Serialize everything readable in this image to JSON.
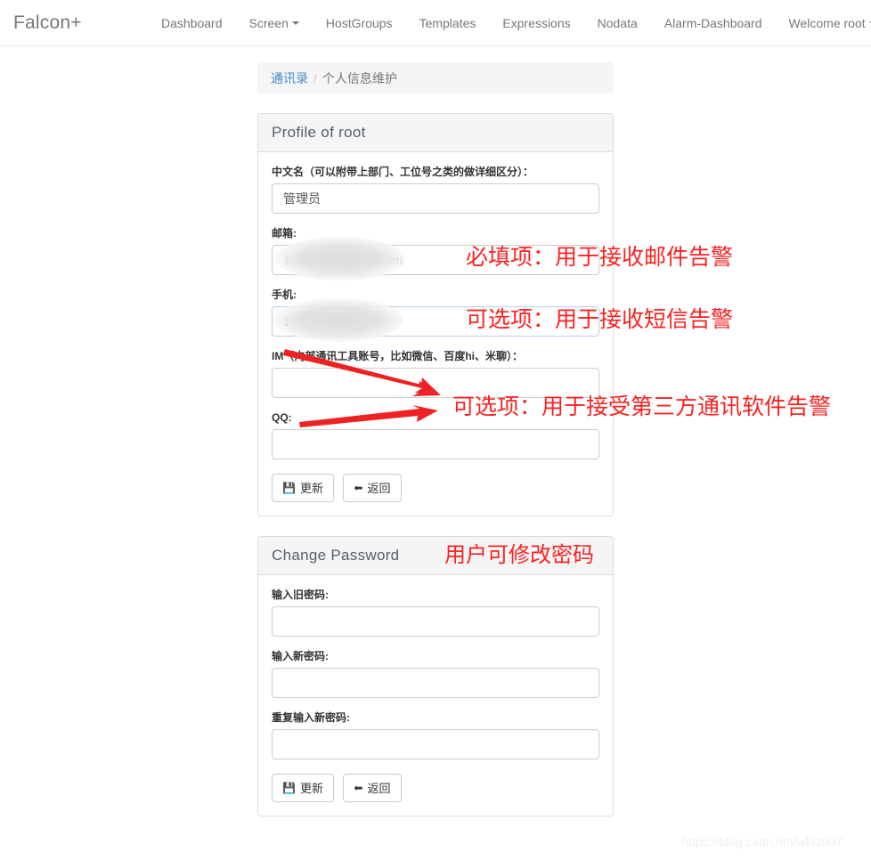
{
  "navbar": {
    "brand": "Falcon+",
    "items": [
      {
        "label": "Dashboard",
        "caret": false
      },
      {
        "label": "Screen",
        "caret": true
      },
      {
        "label": "HostGroups",
        "caret": false
      },
      {
        "label": "Templates",
        "caret": false
      },
      {
        "label": "Expressions",
        "caret": false
      },
      {
        "label": "Nodata",
        "caret": false
      },
      {
        "label": "Alarm-Dashboard",
        "caret": false
      },
      {
        "label": "Welcome root",
        "caret": true
      }
    ]
  },
  "breadcrumb": {
    "link": "通讯录",
    "separator": "/",
    "current": "个人信息维护"
  },
  "profile_panel": {
    "title": "Profile of root",
    "fields": {
      "cnname_label": "中文名（可以附带上部门、工位号之类的做详细区分）：",
      "cnname_value": "管理员",
      "email_label": "邮箱:",
      "email_prefix": "1",
      "email_suffix": "@163.com",
      "phone_label": "手机:",
      "phone_prefix": "1",
      "im_label": "IM（内部通讯工具账号，比如微信、百度hi、米聊）：",
      "im_value": "",
      "qq_label": "QQ:",
      "qq_value": ""
    },
    "buttons": {
      "update": "更新",
      "update_icon": "floppy-disk-icon",
      "back": "返回",
      "back_icon": "arrow-left-icon"
    }
  },
  "password_panel": {
    "title": "Change Password",
    "fields": {
      "old_label": "输入旧密码:",
      "old_value": "",
      "new_label": "输入新密码:",
      "new_value": "",
      "repeat_label": "重复输入新密码:",
      "repeat_value": ""
    },
    "buttons": {
      "update": "更新",
      "update_icon": "floppy-disk-icon",
      "back": "返回",
      "back_icon": "arrow-left-icon"
    }
  },
  "annotations": {
    "color": "#fb2222",
    "email_note": "必填项：用于接收邮件告警",
    "phone_note": "可选项：用于接收短信告警",
    "im_qq_note": "可选项：用于接受第三方通讯软件告警",
    "password_note": "用户可修改密码"
  },
  "watermark": "https://blog.csdn.net/wkl1007"
}
